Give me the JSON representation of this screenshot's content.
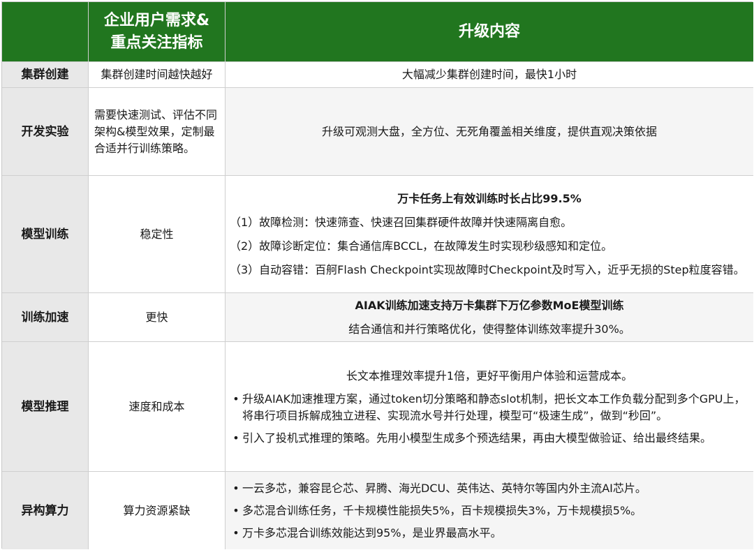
{
  "header": {
    "col1": "",
    "col2": "企业用户需求&\n重点关注指标",
    "col3": "升级内容"
  },
  "rows": {
    "cluster": {
      "category": "集群创建",
      "requirement": "集群创建时间越快越好",
      "upgrade": "大幅减少集群创建时间，最快1小时"
    },
    "dev": {
      "category": "开发实验",
      "requirement": "需要快速测试、评估不同架构&模型效果，定制最合适并行训练策略。",
      "upgrade": "升级可观测大盘，全方位、无死角覆盖相关维度，提供直观决策依据"
    },
    "training": {
      "category": "模型训练",
      "requirement": "稳定性",
      "headline": "万卡任务上有效训练时长占比99.5%",
      "items": [
        "（1）故障检测：快速筛查、快速召回集群硬件故障并快速隔离自愈。",
        "（2）故障诊断定位：集合通信库BCCL，在故障发生时实现秒级感知和定位。",
        "（3）自动容错：百舸Flash Checkpoint实现故障时Checkpoint及时写入，近乎无损的Step粒度容错。"
      ]
    },
    "accel": {
      "category": "训练加速",
      "requirement": "更快",
      "headline": "AIAK训练加速支持万卡集群下万亿参数MoE模型训练",
      "text": "结合通信和并行策略优化，使得整体训练效率提升30%。"
    },
    "inference": {
      "category": "模型推理",
      "requirement": "速度和成本",
      "headline": "长文本推理效率提升1倍，更好平衡用户体验和运营成本。",
      "bullets": [
        "升级AIAK加速推理方案，通过token切分策略和静态slot机制，把长文本工作负载分配到多个GPU上，将串行项目拆解成独立进程、实现流水号并行处理，模型可“极速生成”，做到“秒回”。",
        "引入了投机式推理的策略。先用小模型生成多个预选结果，再由大模型做验证、给出最终结果。"
      ]
    },
    "hetero": {
      "category": "异构算力",
      "requirement": "算力资源紧缺",
      "bullets": [
        "一云多芯，兼容昆仑芯、昇腾、海光DCU、英伟达、英特尔等国内外主流AI芯片。",
        "多芯混合训练任务，千卡规模性能损失5%，百卡规模损失3%，万卡规模损5%。",
        "万卡多芯混合训练效能达到95%，是业界最高水平。"
      ]
    }
  },
  "bullet_char": "•",
  "colors": {
    "header_bg": "#21761f",
    "header_text": "#ffffff",
    "category_bg": "#e8e8e8",
    "upgrade_bg": "#f5f5f5"
  }
}
